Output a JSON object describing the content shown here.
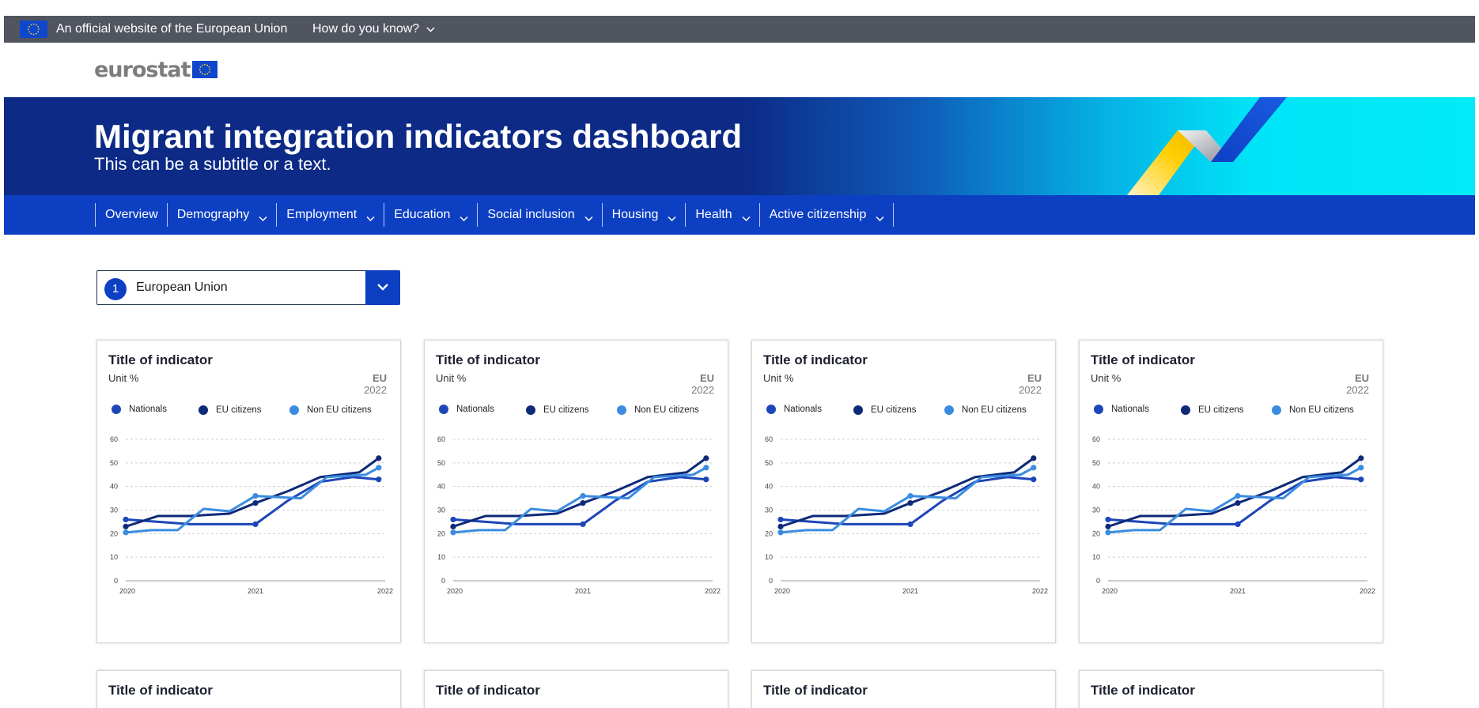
{
  "eu_bar": {
    "official_text": "An official website of the European Union",
    "how_text": "How do you know?",
    "flag_icon": "eu-flag-icon"
  },
  "logo": {
    "text": "eurostat"
  },
  "banner": {
    "title": "Migrant integration indicators dashboard",
    "subtitle": "This can be a subtitle or a text."
  },
  "menu": {
    "items": [
      {
        "label": "Overview",
        "has_dropdown": false
      },
      {
        "label": "Demography",
        "has_dropdown": true
      },
      {
        "label": "Employment",
        "has_dropdown": true
      },
      {
        "label": "Education",
        "has_dropdown": true
      },
      {
        "label": "Social inclusion",
        "has_dropdown": true
      },
      {
        "label": "Housing",
        "has_dropdown": true
      },
      {
        "label": "Health",
        "has_dropdown": true
      },
      {
        "label": "Active citizenship",
        "has_dropdown": true
      }
    ]
  },
  "country_select": {
    "badge": "1",
    "value": "European Union"
  },
  "colors": {
    "menu_blue": "#0d3fc3",
    "nationals": "#1d46b8",
    "eu_citizens": "#0e2a78",
    "non_eu_citizens": "#3b8ce0"
  },
  "cards": [
    {
      "title": "Title of indicator",
      "unit": "Unit %",
      "geo": "EU",
      "year": "2022"
    },
    {
      "title": "Title of indicator",
      "unit": "Unit %",
      "geo": "EU",
      "year": "2022"
    },
    {
      "title": "Title of indicator",
      "unit": "Unit %",
      "geo": "EU",
      "year": "2022"
    },
    {
      "title": "Title of indicator",
      "unit": "Unit %",
      "geo": "EU",
      "year": "2022"
    },
    {
      "title": "Title of indicator"
    },
    {
      "title": "Title of indicator"
    },
    {
      "title": "Title of indicator"
    },
    {
      "title": "Title of indicator"
    }
  ],
  "chart_data": {
    "type": "line",
    "xlim": [
      2020,
      2022
    ],
    "ylim": [
      0,
      60
    ],
    "yticks": [
      0,
      10,
      20,
      30,
      40,
      50,
      60
    ],
    "xticks": [
      2020,
      2021,
      2022
    ],
    "grid": true,
    "legend_position": "top",
    "series": [
      {
        "name": "Nationals",
        "color": "#1d46b8",
        "x": [
          2020,
          2020.25,
          2020.5,
          2020.75,
          2021,
          2021.25,
          2021.5,
          2021.75,
          2021.95
        ],
        "y": [
          26,
          25,
          24,
          24,
          24,
          34,
          42,
          44,
          43
        ]
      },
      {
        "name": "EU citizens",
        "color": "#0e2a78",
        "x": [
          2020,
          2020.25,
          2020.5,
          2020.8,
          2021,
          2021.25,
          2021.5,
          2021.8,
          2021.95
        ],
        "y": [
          23,
          27.5,
          27.5,
          28.5,
          33,
          38,
          44,
          46,
          52
        ]
      },
      {
        "name": "Non EU citizens",
        "color": "#3b8ce0",
        "x": [
          2020,
          2020.2,
          2020.4,
          2020.6,
          2020.8,
          2021,
          2021.35,
          2021.55,
          2021.85,
          2021.95
        ],
        "y": [
          20.5,
          21.5,
          21.5,
          30.5,
          29.5,
          36,
          35,
          44,
          45,
          48
        ]
      }
    ]
  }
}
